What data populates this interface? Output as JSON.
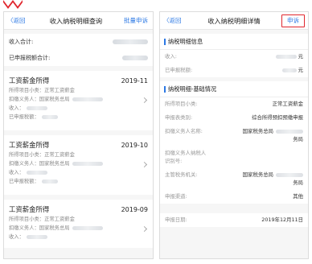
{
  "colors": {
    "accent": "#2b78e4",
    "highlight_border": "#e0262d",
    "brand_mark": "#e0262d"
  },
  "left_screen": {
    "nav": {
      "back_label": "〈返回",
      "title": "收入纳税明细查询",
      "action_label": "批量申诉"
    },
    "summary": [
      {
        "label": "收入合计:"
      },
      {
        "label": "已申报税额合计:"
      }
    ],
    "cards": [
      {
        "title": "工资薪金所得",
        "date": "2019-11",
        "item_line": "所得项目小类：正常工资薪金",
        "withholder_line": "扣缴义务人：国家税务总局",
        "income_label": "收入：",
        "tax_label": "已申报税额："
      },
      {
        "title": "工资薪金所得",
        "date": "2019-10",
        "item_line": "所得项目小类：正常工资薪金",
        "withholder_line": "扣缴义务人：国家税务总局",
        "income_label": "收入：",
        "tax_label": "已申报税额："
      },
      {
        "title": "工资薪金所得",
        "date": "2019-09",
        "item_line": "所得项目小类：正常工资薪金",
        "withholder_line": "扣缴义务人：国家税务总局",
        "income_label": "收入："
      }
    ]
  },
  "right_screen": {
    "nav": {
      "back_label": "〈返回",
      "title": "收入纳税明细详情",
      "action_label": "申诉"
    },
    "tax_info": {
      "heading": "纳税明细信息",
      "rows": [
        {
          "label": "收入:",
          "unit": "元"
        },
        {
          "label": "已申报税额:",
          "unit": "元"
        }
      ]
    },
    "basic": {
      "heading": "纳税明细-基础情况",
      "rows": [
        {
          "label": "所得项目小类:",
          "value": "正常工资薪金"
        },
        {
          "label": "申报表类别:",
          "value": "综合所得预扣预缴申报"
        },
        {
          "label": "扣缴义务人名称:",
          "value": "国家税务总局",
          "value_tail": "务局"
        },
        {
          "label": "扣缴义务人纳税人识别号:",
          "value": ""
        },
        {
          "label": "主管税务机关:",
          "value": "国家税务总局",
          "value_tail": "务局"
        },
        {
          "label": "申报渠道:",
          "value": "其他"
        },
        {
          "label": "申报日期:",
          "value": "2019年12月11日"
        }
      ]
    }
  }
}
